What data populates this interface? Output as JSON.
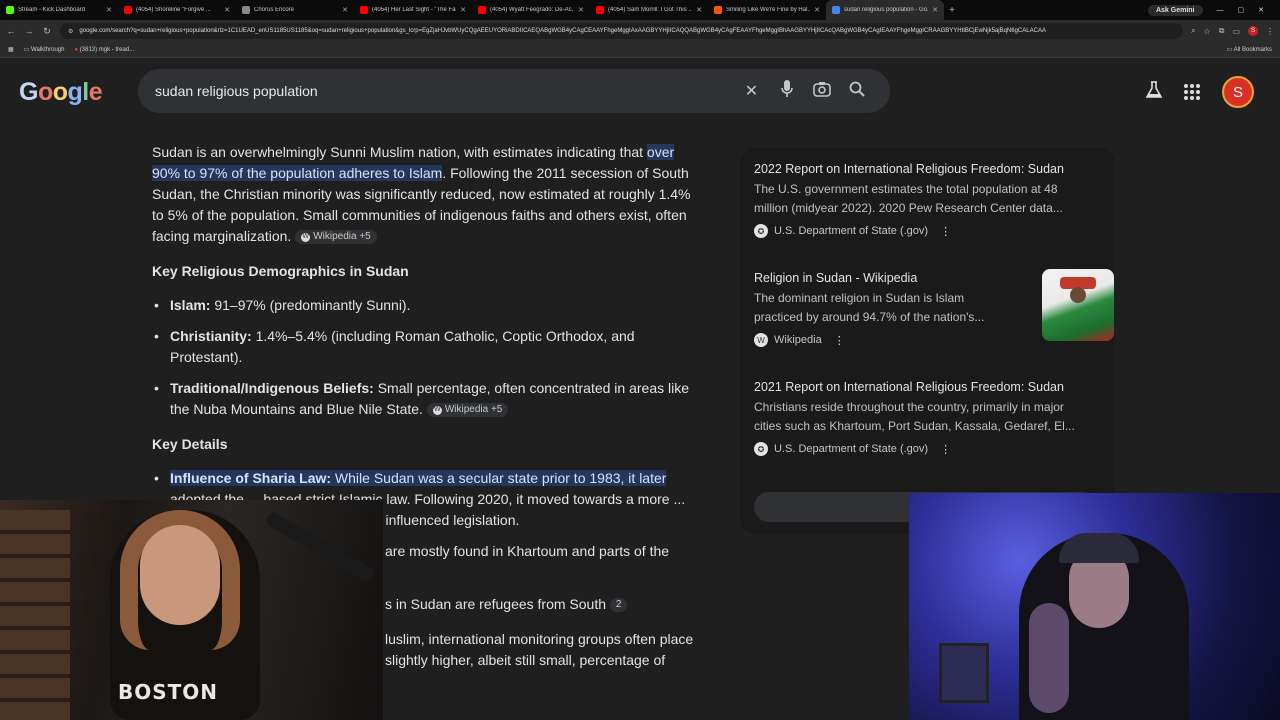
{
  "browser": {
    "tabs": [
      {
        "title": "Stream - Kick Dashboard",
        "color": "#53fc18"
      },
      {
        "title": "(4054) Shoreline \"Forgive ...",
        "color": "#ff0000"
      },
      {
        "title": "Chorus Encore",
        "color": "#888888"
      },
      {
        "title": "(4054) Her Last Sight - \"The Fal...",
        "color": "#ff0000"
      },
      {
        "title": "(4054) Wyatt Feegrado: De-Ac...",
        "color": "#ff0000"
      },
      {
        "title": "(4054) Sam Morrill: I Got This ...",
        "color": "#ff0000"
      },
      {
        "title": "Smiling Like We're Fine by Hal...",
        "color": "#ff5500"
      },
      {
        "title": "sudan religious population - Go...",
        "color": "#4285f4"
      }
    ],
    "ask_gemini": "Ask Gemini",
    "url": "google.com/search?q=sudan+religious+population&rlz=1C1UEAD_enUS1185US1185&oq=sudan+religious+population&gs_lcrp=EgZjaHJvbWUyCQgAEEUYORiABDIICAEQABgWGB4yCAgCEAAYFhgeMggIAxAAGBYYHjIICAQQABgWGB4yCAgFEAAYFhgeMggIBhAAGBYYHjIICAcQABgWGB4yCAgIEAAYFhgeMggICRAAGBYYHtIBCjEwNjk5ajBqN6gCALACAA",
    "bookmarks": [
      "Walkthrough",
      "(3813) mgk - tread..."
    ],
    "all_bookmarks": "All Bookmarks"
  },
  "google": {
    "logo_letters": [
      "G",
      "o",
      "o",
      "g",
      "l",
      "e"
    ],
    "query": "sudan religious population",
    "avatar_letter": "S"
  },
  "overview": {
    "p1_before": "Sudan is an overwhelmingly Sunni Muslim nation, with estimates indicating that ",
    "p1_highlight": "over 90% to 97% of the population adheres to Islam",
    "p1_after": ". Following the 2011 secession of South Sudan, the Christian minority was significantly reduced, now estimated at roughly 1.4% to 5% of the population. Small communities of indigenous faiths and others exist, often facing marginalization. ",
    "p1_source": "Wikipedia +5",
    "h_demographics": "Key Religious Demographics in Sudan",
    "demographics": [
      {
        "label": "Islam:",
        "text": " 91–97% (predominantly Sunni).",
        "source": ""
      },
      {
        "label": "Christianity:",
        "text": " 1.4%–5.4% (including Roman Catholic, Coptic Orthodox, and Protestant).",
        "source": ""
      },
      {
        "label": "Traditional/Indigenous Beliefs:",
        "text": " Small percentage, often concentrated in areas like the Nuba Mountains and Blue Nile State. ",
        "source": "Wikipedia +5"
      }
    ],
    "h_details": "Key Details",
    "d1_label": "Influence of Sharia Law:",
    "d1_highlight": " While Sudan was a secular state prior to 1983, it later",
    "d1_rest": " adopted the ... based strict Islamic law. Following 2020, it moved towards a more ... Islamic law has historically heavily influenced legislation.",
    "d2_text": "are mostly found in Khartoum and parts of the",
    "d3_text": "s in Sudan are refugees from South",
    "d3_source": "2",
    "d4_text": "luslim, international monitoring groups often place",
    "d5_text": "slightly higher, albeit still small, percentage of"
  },
  "sources": [
    {
      "title": "2022 Report on International Religious Freedom: Sudan",
      "snippet": "The U.S. government estimates the total population at 48 million (midyear 2022). 2020 Pew Research Center data...",
      "site": "U.S. Department of State (.gov)",
      "icon": "seal-icon"
    },
    {
      "title": "Religion in Sudan - Wikipedia",
      "snippet": "The dominant religion in Sudan is Islam practiced by around 94.7% of the nation's...",
      "site": "Wikipedia",
      "icon": "wikipedia-icon"
    },
    {
      "title": "2021 Report on International Religious Freedom: Sudan",
      "snippet": "Christians reside throughout the country, primarily in major cities such as Khartoum, Port Sudan, Kassala, Gedaref, El...",
      "site": "U.S. Department of State (.gov)",
      "icon": "seal-icon"
    }
  ],
  "webcam_left": {
    "shirt_text": "BOSTON"
  }
}
